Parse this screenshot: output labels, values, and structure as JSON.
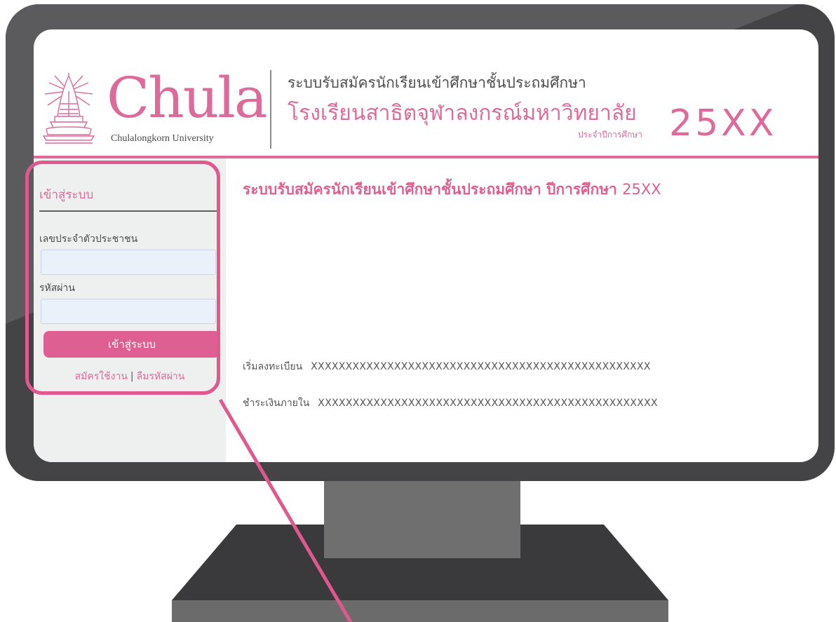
{
  "header": {
    "logo_text": "Chula",
    "logo_subtitle": "Chulalongkorn University",
    "system_title": "ระบบรับสมัครนักเรียนเข้าศึกษาชั้นประถมศึกษา",
    "school_name": "โรงเรียนสาธิตจุฬาลงกรณ์มหาวิทยาลัย",
    "academic_year_label": "ประจำปีการศึกษา",
    "academic_year": "25XX"
  },
  "sidebar": {
    "login_title": "เข้าสู่ระบบ",
    "id_label": "เลขประจำตัวประชาชน",
    "id_value": "",
    "password_label": "รหัสผ่าน",
    "password_value": "",
    "login_button": "เข้าสู่ระบบ",
    "register_link": "สมัครใช้งาน",
    "separator": "|",
    "forgot_link": "ลืมรหัสผ่าน"
  },
  "main": {
    "title": "ระบบรับสมัครนักเรียนเข้าศึกษาชั้นประถมศึกษา ปีการศึกษา",
    "title_year": "25XX",
    "registration_label": "เริ่มลงทะเบียน",
    "registration_value": "XXXXXXXXXXXXXXXXXXXXXXXXXXXXXXXXXXXXXXXXXXXXXXXXX",
    "payment_label": "ชำระเงินภายใน",
    "payment_value": "XXXXXXXXXXXXXXXXXXXXXXXXXXXXXXXXXXXXXXXXXXXXXXXXX"
  },
  "colors": {
    "accent": "#de6a9b",
    "button": "#de5f91",
    "bezel": "#444447",
    "sidebar_bg": "#eef0ef"
  },
  "icons": {
    "emblem": "chulalongkorn-emblem-icon"
  }
}
